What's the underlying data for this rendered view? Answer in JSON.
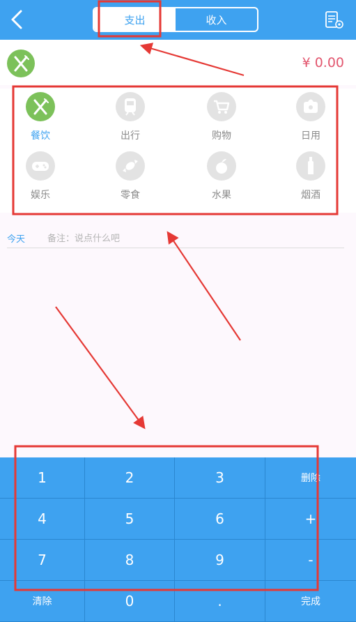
{
  "tabs": [
    {
      "label": "支出",
      "active": true
    },
    {
      "label": "收入",
      "active": false
    }
  ],
  "amount": "¥ 0.00",
  "categories": [
    {
      "label": "餐饮",
      "icon": "cutlery-icon",
      "active": true
    },
    {
      "label": "出行",
      "icon": "train-icon",
      "active": false
    },
    {
      "label": "购物",
      "icon": "cart-icon",
      "active": false
    },
    {
      "label": "日用",
      "icon": "tissue-icon",
      "active": false
    },
    {
      "label": "娱乐",
      "icon": "gamepad-icon",
      "active": false
    },
    {
      "label": "零食",
      "icon": "candy-icon",
      "active": false
    },
    {
      "label": "水果",
      "icon": "fruit-icon",
      "active": false
    },
    {
      "label": "烟酒",
      "icon": "bottle-icon",
      "active": false
    }
  ],
  "date_label": "今天",
  "note": {
    "placeholder": "备注：说点什么吧",
    "value": ""
  },
  "keypad": [
    "1",
    "2",
    "3",
    "删除",
    "4",
    "5",
    "6",
    "+",
    "7",
    "8",
    "9",
    "-",
    "清除",
    "0",
    ".",
    "完成"
  ],
  "colors": {
    "primary": "#3ea2f0",
    "selected_category": "#7cc15a",
    "amount": "#e2566e",
    "inactive_icon": "#e3e3e3",
    "annotation": "#e53935"
  }
}
